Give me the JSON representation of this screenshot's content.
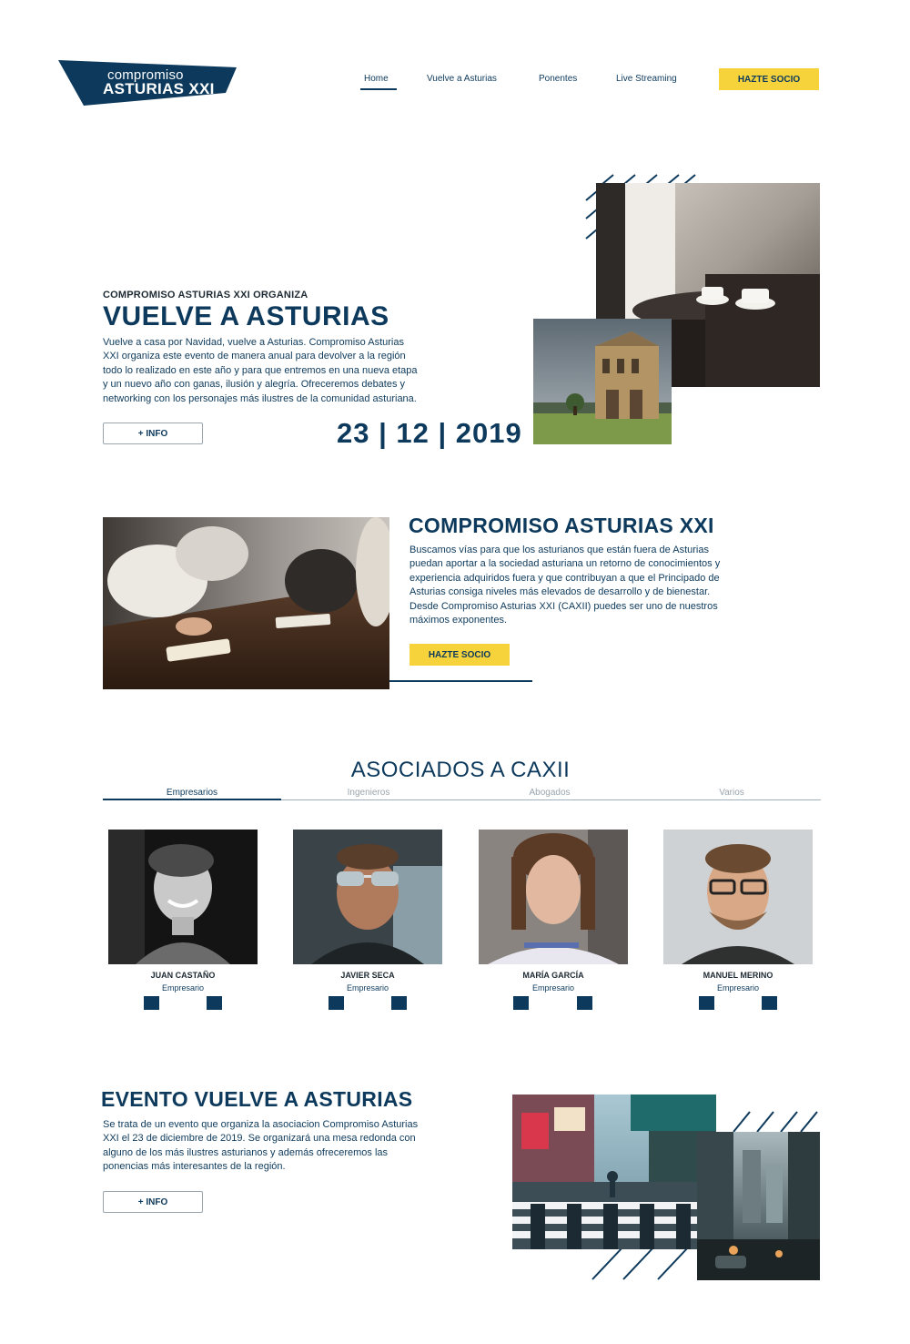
{
  "header": {
    "logo": {
      "line1": "compromiso",
      "line2": "ASTURIAS XXI"
    },
    "nav": [
      {
        "label": "Home",
        "active": true
      },
      {
        "label": "Vuelve a Asturias",
        "active": false
      },
      {
        "label": "Ponentes",
        "active": false
      },
      {
        "label": "Live Streaming",
        "active": false
      }
    ],
    "cta_label": "HAZTE SOCIO"
  },
  "hero": {
    "kicker": "COMPROMISO ASTURIAS XXI ORGANIZA",
    "title": "VUELVE A ASTURIAS",
    "paragraph_lines": [
      "Vuelve a casa por Navidad, vuelve a Asturias. Compromiso Asturias",
      "XXI organiza este evento de manera anual para devolver a la región",
      "todo lo realizado en este año y para que entremos en una nueva etapa",
      "y un nuevo año con ganas, ilusión y alegría. Ofreceremos debates y",
      "networking con los personajes más ilustres de la comunidad asturiana."
    ],
    "info_button": "+ INFO",
    "date": "23 | 12 | 2019"
  },
  "about": {
    "title": "COMPROMISO ASTURIAS XXI",
    "paragraph_lines": [
      "Buscamos vías para que los asturianos que están fuera de Asturias",
      "puedan aportar a la sociedad asturiana un retorno de conocimientos y",
      "experiencia adquiridos fuera y que contribuyan a que el Principado de",
      "Asturias consiga niveles más elevados de desarrollo y de bienestar.",
      "Desde Compromiso Asturias XXI (CAXII) puedes ser uno de nuestros",
      "máximos exponentes."
    ],
    "cta_label": "HAZTE SOCIO"
  },
  "associates": {
    "title": "ASOCIADOS A CAXII",
    "tabs": [
      {
        "label": "Empresarios",
        "active": true
      },
      {
        "label": "Ingenieros",
        "active": false
      },
      {
        "label": "Abogados",
        "active": false
      },
      {
        "label": "Varios",
        "active": false
      }
    ],
    "members": [
      {
        "name": "JUAN CASTAÑO",
        "role": "Empresario"
      },
      {
        "name": "JAVIER SECA",
        "role": "Empresario"
      },
      {
        "name": "MARÍA GARCÍA",
        "role": "Empresario"
      },
      {
        "name": "MANUEL MERINO",
        "role": "Empresario"
      }
    ]
  },
  "event": {
    "title": "EVENTO VUELVE A ASTURIAS",
    "paragraph_lines": [
      "Se trata de un evento que organiza la asociacion Compromiso Asturias",
      "XXI el 23 de diciembre de 2019. Se organizará una mesa redonda con",
      "alguno de los más ilustres asturianos y además ofreceremos las",
      "ponencias más interesantes de la región."
    ],
    "info_button": "+ INFO"
  },
  "colors": {
    "primary": "#0d3a5c",
    "accent": "#f6d33b",
    "background": "#ffffff"
  }
}
